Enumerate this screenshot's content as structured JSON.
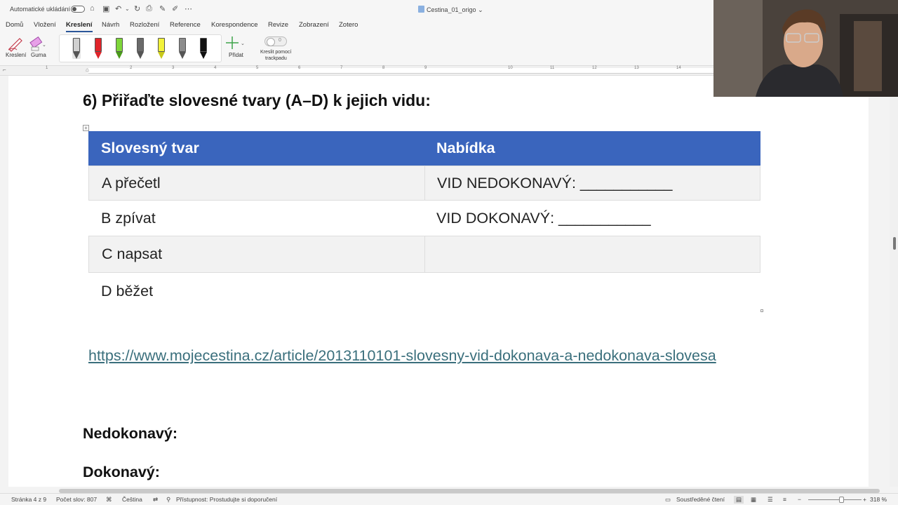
{
  "titlebar": {
    "autosave_label": "Automatické ukládání",
    "document_title": "Cestina_01_origo"
  },
  "tabs": [
    "Domů",
    "Vložení",
    "Kreslení",
    "Návrh",
    "Rozložení",
    "Reference",
    "Korespondence",
    "Revize",
    "Zobrazení",
    "Zotero"
  ],
  "active_tab": "Kreslení",
  "ribbon": {
    "draw_label": "Kreslení",
    "eraser_label": "Guma",
    "add_label": "Přidat",
    "trackpad_toggle_value": "0",
    "trackpad_label_line1": "Kreslit pomocí",
    "trackpad_label_line2": "trackpadu",
    "pens": [
      {
        "name": "pencil-gray",
        "color": "#d0d0d0"
      },
      {
        "name": "pen-red",
        "color": "#e0242a"
      },
      {
        "name": "highlighter-green",
        "color": "#7ed63a"
      },
      {
        "name": "pencil-dark",
        "color": "#6a6a6a"
      },
      {
        "name": "highlighter-yellow",
        "color": "#f2f23a"
      },
      {
        "name": "pen-gray",
        "color": "#8c8c8c"
      },
      {
        "name": "pen-black",
        "color": "#111111"
      }
    ]
  },
  "ruler_numbers": [
    "1",
    "2",
    "3",
    "4",
    "5",
    "6",
    "7",
    "8",
    "9",
    "10",
    "11",
    "12",
    "13",
    "14"
  ],
  "document": {
    "heading": "6)  Přiřaďte slovesné tvary (A–D) k jejich vidu:",
    "table": {
      "headers": [
        "Slovesný tvar",
        "Nabídka"
      ],
      "rows": [
        [
          "A  přečetl",
          "VID NEDOKONAVÝ: ___________"
        ],
        [
          "B  zpívat",
          "VID DOKONAVÝ: ___________"
        ],
        [
          "C  napsat",
          ""
        ],
        [
          "D  běžet",
          ""
        ]
      ]
    },
    "link": "https://www.mojecestina.cz/article/2013110101-slovesny-vid-dokonava-a-nedokonava-slovesa",
    "label_imperfective": "Nedokonavý:",
    "label_perfective": "Dokonavý:"
  },
  "status": {
    "page": "Stránka 4 z 9",
    "words": "Počet slov: 807",
    "language": "Čeština",
    "accessibility": "Přístupnost: Prostudujte si doporučení",
    "focus": "Soustředěné čtení",
    "zoom": "318 %"
  },
  "colors": {
    "table_header": "#3a65bd",
    "link": "#3a6f7c",
    "accent": "#2b579a"
  }
}
